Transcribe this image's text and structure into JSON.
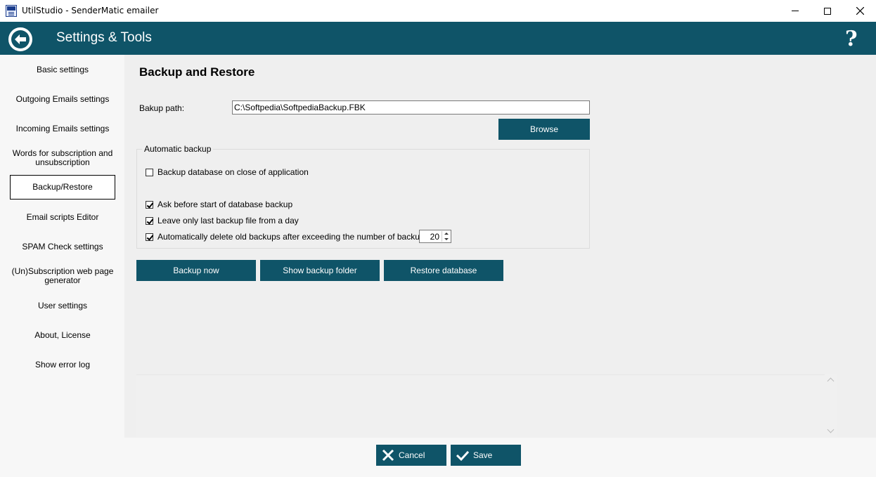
{
  "window": {
    "title": "UtilStudio - SenderMatic emailer"
  },
  "header": {
    "title": "Settings & Tools",
    "help": "?"
  },
  "sidebar": {
    "items": [
      {
        "label": "Basic settings"
      },
      {
        "label": "Outgoing Emails settings"
      },
      {
        "label": "Incoming Emails settings"
      },
      {
        "label": "Words for subscription and unsubscription"
      },
      {
        "label": "Backup/Restore",
        "active": true
      },
      {
        "label": "Email scripts Editor"
      },
      {
        "label": "SPAM Check settings"
      },
      {
        "label": "(Un)Subscription web page generator"
      },
      {
        "label": "User settings"
      },
      {
        "label": "About, License"
      },
      {
        "label": "Show error log"
      }
    ]
  },
  "main": {
    "title": "Backup and Restore",
    "backup_path_label": "Bakup path:",
    "backup_path_value": "C:\\Softpedia\\SoftpediaBackup.FBK",
    "browse_label": "Browse",
    "auto_backup": {
      "legend": "Automatic backup",
      "options": [
        {
          "label": "Backup database on close of application",
          "checked": false
        },
        {
          "label": "Ask before start of database backup",
          "checked": true
        },
        {
          "label": "Leave only last backup file from a day",
          "checked": true
        },
        {
          "label": "Automatically delete old backups after exceeding the number of backups",
          "checked": true
        }
      ],
      "max_backups": "20"
    },
    "actions": {
      "backup_now": "Backup now",
      "show_folder": "Show backup folder",
      "restore": "Restore database"
    }
  },
  "footer": {
    "cancel_label": "Cancel",
    "save_label": "Save"
  },
  "colors": {
    "accent": "#0f5468",
    "main_bg": "#efefef",
    "sidebar_bg": "#f7f7f7"
  },
  "icons": [
    "app-icon",
    "minimize-icon",
    "maximize-icon",
    "close-icon",
    "back-arrow-icon",
    "help-icon",
    "cancel-x-icon",
    "save-check-icon"
  ]
}
